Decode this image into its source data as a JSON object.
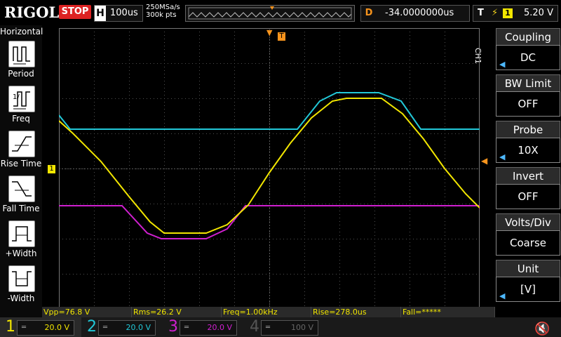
{
  "topbar": {
    "logo": "RIGOL",
    "run_state": "STOP",
    "horizontal_label": "H",
    "timebase": "100us",
    "sample_rate": "250MSa/s",
    "memory_depth": "300k pts",
    "delay_label": "D",
    "delay_value": "-34.0000000us",
    "trigger_label": "T",
    "trigger_edge_symbol": "⚡",
    "trigger_channel": "1",
    "trigger_level": "5.20 V"
  },
  "left_panel": {
    "title": "Horizontal",
    "items": [
      {
        "label": "Period",
        "icon": "period-icon"
      },
      {
        "label": "Freq",
        "icon": "frequency-icon"
      },
      {
        "label": "Rise Time",
        "icon": "rise-time-icon"
      },
      {
        "label": "Fall Time",
        "icon": "fall-time-icon"
      },
      {
        "label": "+Width",
        "icon": "positive-width-icon"
      },
      {
        "label": "-Width",
        "icon": "negative-width-icon"
      }
    ]
  },
  "right_panel": {
    "channel_tag": "CH1",
    "items": [
      {
        "title": "Coupling",
        "value": "DC",
        "has_arrow": true
      },
      {
        "title": "BW Limit",
        "value": "OFF",
        "has_arrow": false
      },
      {
        "title": "Probe",
        "value": "10X",
        "has_arrow": true
      },
      {
        "title": "Invert",
        "value": "OFF",
        "has_arrow": false
      },
      {
        "title": "Volts/Div",
        "value": "Coarse",
        "has_arrow": false
      },
      {
        "title": "Unit",
        "value": "[V]",
        "has_arrow": true
      }
    ]
  },
  "markers": {
    "trigger_pos": "T",
    "ch1_ground": "1"
  },
  "measurements": [
    {
      "text": "Vpp=76.8 V"
    },
    {
      "text": "Rms=26.2 V"
    },
    {
      "text": "Freq=1.00kHz"
    },
    {
      "text": "Rise=278.0us"
    },
    {
      "text": "Fall=*****"
    }
  ],
  "channels": [
    {
      "num": "1",
      "bw": "═",
      "scale": "20.0 V",
      "color": "#f2e600",
      "active": true
    },
    {
      "num": "2",
      "bw": "═",
      "scale": "20.0 V",
      "color": "#22c8d8",
      "active": false
    },
    {
      "num": "3",
      "bw": "═",
      "scale": "20.0 V",
      "color": "#d020d0",
      "active": false
    },
    {
      "num": "4",
      "bw": "═",
      "scale": "100 V",
      "color": "#3050ff",
      "active": false
    }
  ],
  "colors": {
    "ch1": "#f2e600",
    "ch2": "#22c8d8",
    "ch3": "#d020d0",
    "trigger_marker": "#f7941d",
    "grid": "#5a5a5a"
  }
}
